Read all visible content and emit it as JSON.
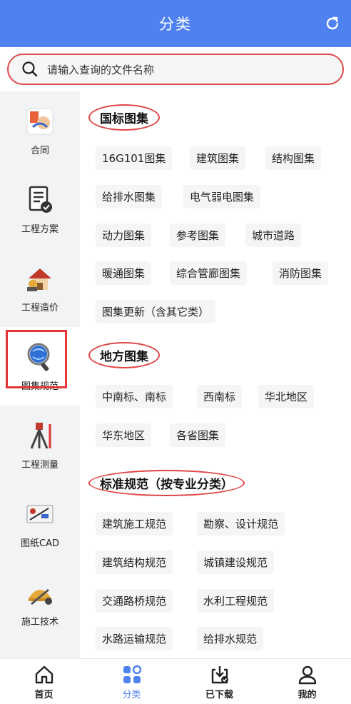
{
  "header": {
    "title": "分类"
  },
  "search": {
    "placeholder": "请输入查询的文件名称"
  },
  "sidebar": {
    "items": [
      {
        "label": "合同",
        "icon": "contract-icon"
      },
      {
        "label": "工程方案",
        "icon": "document-check-icon"
      },
      {
        "label": "工程造价",
        "icon": "house-calculator-icon"
      },
      {
        "label": "图集规范",
        "icon": "magnifier-globe-icon"
      },
      {
        "label": "工程测量",
        "icon": "surveying-tripod-icon"
      },
      {
        "label": "图纸CAD",
        "icon": "cad-drawing-icon"
      },
      {
        "label": "施工技术",
        "icon": "construction-tools-icon"
      }
    ],
    "active_index": 3
  },
  "sections": [
    {
      "title": "国标图集",
      "tags": [
        "16G101图集",
        "建筑图集",
        "结构图集",
        "给排水图集",
        "电气弱电图集",
        "动力图集",
        "参考图集",
        "城市道路",
        "暖通图集",
        "综合管廊图集",
        "消防图集",
        "图集更新（含其它类）"
      ]
    },
    {
      "title": "地方图集",
      "tags": [
        "中南标、南标",
        "西南标",
        "华北地区",
        "华东地区",
        "各省图集"
      ]
    },
    {
      "title": "标准规范（按专业分类）",
      "tags": [
        "建筑施工规范",
        "勘察、设计规范",
        "建筑结构规范",
        "城镇建设规范",
        "交通路桥规范",
        "水利工程规范",
        "水路运输规范",
        "给排水规范"
      ]
    }
  ],
  "tabbar": {
    "items": [
      {
        "label": "首页",
        "icon": "home-icon"
      },
      {
        "label": "分类",
        "icon": "grid-icon"
      },
      {
        "label": "已下载",
        "icon": "download-icon"
      },
      {
        "label": "我的",
        "icon": "user-icon"
      }
    ],
    "active_index": 1
  },
  "colors": {
    "primary": "#4f81f0",
    "highlight": "#e53535",
    "sidebar_bg": "#f2f3f5",
    "tag_bg": "#f4f5f7"
  }
}
